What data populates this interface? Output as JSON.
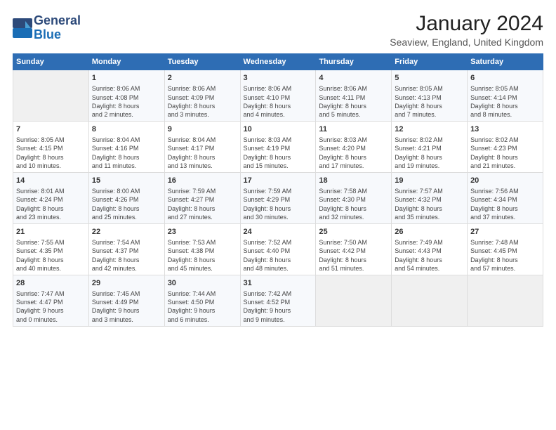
{
  "header": {
    "logo_line1": "General",
    "logo_line2": "Blue",
    "main_title": "January 2024",
    "subtitle": "Seaview, England, United Kingdom"
  },
  "days_of_week": [
    "Sunday",
    "Monday",
    "Tuesday",
    "Wednesday",
    "Thursday",
    "Friday",
    "Saturday"
  ],
  "weeks": [
    [
      {
        "date": "",
        "sunrise": "",
        "sunset": "",
        "daylight": ""
      },
      {
        "date": "1",
        "sunrise": "Sunrise: 8:06 AM",
        "sunset": "Sunset: 4:08 PM",
        "daylight": "Daylight: 8 hours and 2 minutes."
      },
      {
        "date": "2",
        "sunrise": "Sunrise: 8:06 AM",
        "sunset": "Sunset: 4:09 PM",
        "daylight": "Daylight: 8 hours and 3 minutes."
      },
      {
        "date": "3",
        "sunrise": "Sunrise: 8:06 AM",
        "sunset": "Sunset: 4:10 PM",
        "daylight": "Daylight: 8 hours and 4 minutes."
      },
      {
        "date": "4",
        "sunrise": "Sunrise: 8:06 AM",
        "sunset": "Sunset: 4:11 PM",
        "daylight": "Daylight: 8 hours and 5 minutes."
      },
      {
        "date": "5",
        "sunrise": "Sunrise: 8:05 AM",
        "sunset": "Sunset: 4:13 PM",
        "daylight": "Daylight: 8 hours and 7 minutes."
      },
      {
        "date": "6",
        "sunrise": "Sunrise: 8:05 AM",
        "sunset": "Sunset: 4:14 PM",
        "daylight": "Daylight: 8 hours and 8 minutes."
      }
    ],
    [
      {
        "date": "7",
        "sunrise": "Sunrise: 8:05 AM",
        "sunset": "Sunset: 4:15 PM",
        "daylight": "Daylight: 8 hours and 10 minutes."
      },
      {
        "date": "8",
        "sunrise": "Sunrise: 8:04 AM",
        "sunset": "Sunset: 4:16 PM",
        "daylight": "Daylight: 8 hours and 11 minutes."
      },
      {
        "date": "9",
        "sunrise": "Sunrise: 8:04 AM",
        "sunset": "Sunset: 4:17 PM",
        "daylight": "Daylight: 8 hours and 13 minutes."
      },
      {
        "date": "10",
        "sunrise": "Sunrise: 8:03 AM",
        "sunset": "Sunset: 4:19 PM",
        "daylight": "Daylight: 8 hours and 15 minutes."
      },
      {
        "date": "11",
        "sunrise": "Sunrise: 8:03 AM",
        "sunset": "Sunset: 4:20 PM",
        "daylight": "Daylight: 8 hours and 17 minutes."
      },
      {
        "date": "12",
        "sunrise": "Sunrise: 8:02 AM",
        "sunset": "Sunset: 4:21 PM",
        "daylight": "Daylight: 8 hours and 19 minutes."
      },
      {
        "date": "13",
        "sunrise": "Sunrise: 8:02 AM",
        "sunset": "Sunset: 4:23 PM",
        "daylight": "Daylight: 8 hours and 21 minutes."
      }
    ],
    [
      {
        "date": "14",
        "sunrise": "Sunrise: 8:01 AM",
        "sunset": "Sunset: 4:24 PM",
        "daylight": "Daylight: 8 hours and 23 minutes."
      },
      {
        "date": "15",
        "sunrise": "Sunrise: 8:00 AM",
        "sunset": "Sunset: 4:26 PM",
        "daylight": "Daylight: 8 hours and 25 minutes."
      },
      {
        "date": "16",
        "sunrise": "Sunrise: 7:59 AM",
        "sunset": "Sunset: 4:27 PM",
        "daylight": "Daylight: 8 hours and 27 minutes."
      },
      {
        "date": "17",
        "sunrise": "Sunrise: 7:59 AM",
        "sunset": "Sunset: 4:29 PM",
        "daylight": "Daylight: 8 hours and 30 minutes."
      },
      {
        "date": "18",
        "sunrise": "Sunrise: 7:58 AM",
        "sunset": "Sunset: 4:30 PM",
        "daylight": "Daylight: 8 hours and 32 minutes."
      },
      {
        "date": "19",
        "sunrise": "Sunrise: 7:57 AM",
        "sunset": "Sunset: 4:32 PM",
        "daylight": "Daylight: 8 hours and 35 minutes."
      },
      {
        "date": "20",
        "sunrise": "Sunrise: 7:56 AM",
        "sunset": "Sunset: 4:34 PM",
        "daylight": "Daylight: 8 hours and 37 minutes."
      }
    ],
    [
      {
        "date": "21",
        "sunrise": "Sunrise: 7:55 AM",
        "sunset": "Sunset: 4:35 PM",
        "daylight": "Daylight: 8 hours and 40 minutes."
      },
      {
        "date": "22",
        "sunrise": "Sunrise: 7:54 AM",
        "sunset": "Sunset: 4:37 PM",
        "daylight": "Daylight: 8 hours and 42 minutes."
      },
      {
        "date": "23",
        "sunrise": "Sunrise: 7:53 AM",
        "sunset": "Sunset: 4:38 PM",
        "daylight": "Daylight: 8 hours and 45 minutes."
      },
      {
        "date": "24",
        "sunrise": "Sunrise: 7:52 AM",
        "sunset": "Sunset: 4:40 PM",
        "daylight": "Daylight: 8 hours and 48 minutes."
      },
      {
        "date": "25",
        "sunrise": "Sunrise: 7:50 AM",
        "sunset": "Sunset: 4:42 PM",
        "daylight": "Daylight: 8 hours and 51 minutes."
      },
      {
        "date": "26",
        "sunrise": "Sunrise: 7:49 AM",
        "sunset": "Sunset: 4:43 PM",
        "daylight": "Daylight: 8 hours and 54 minutes."
      },
      {
        "date": "27",
        "sunrise": "Sunrise: 7:48 AM",
        "sunset": "Sunset: 4:45 PM",
        "daylight": "Daylight: 8 hours and 57 minutes."
      }
    ],
    [
      {
        "date": "28",
        "sunrise": "Sunrise: 7:47 AM",
        "sunset": "Sunset: 4:47 PM",
        "daylight": "Daylight: 9 hours and 0 minutes."
      },
      {
        "date": "29",
        "sunrise": "Sunrise: 7:45 AM",
        "sunset": "Sunset: 4:49 PM",
        "daylight": "Daylight: 9 hours and 3 minutes."
      },
      {
        "date": "30",
        "sunrise": "Sunrise: 7:44 AM",
        "sunset": "Sunset: 4:50 PM",
        "daylight": "Daylight: 9 hours and 6 minutes."
      },
      {
        "date": "31",
        "sunrise": "Sunrise: 7:42 AM",
        "sunset": "Sunset: 4:52 PM",
        "daylight": "Daylight: 9 hours and 9 minutes."
      },
      {
        "date": "",
        "sunrise": "",
        "sunset": "",
        "daylight": ""
      },
      {
        "date": "",
        "sunrise": "",
        "sunset": "",
        "daylight": ""
      },
      {
        "date": "",
        "sunrise": "",
        "sunset": "",
        "daylight": ""
      }
    ]
  ]
}
